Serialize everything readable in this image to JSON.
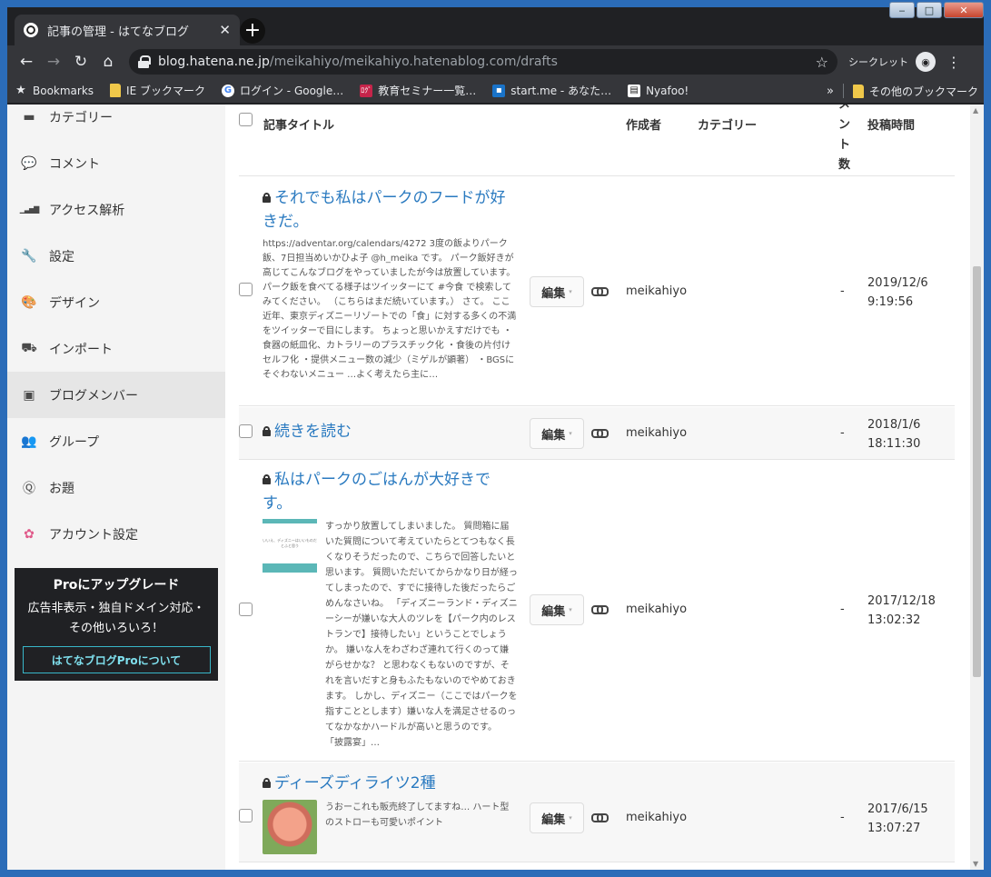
{
  "window": {
    "min_label": "‒",
    "max_label": "□",
    "close_label": "✕"
  },
  "tab": {
    "title": "記事の管理 - はてなブログ",
    "close": "✕",
    "new_tab": "+"
  },
  "toolbar": {
    "back": "←",
    "forward": "→",
    "reload": "↻",
    "home": "⌂",
    "url_host": "blog.hatena.ne.jp",
    "url_path": "/meikahiyo/meikahiyo.hatenablog.com/drafts",
    "star": "☆",
    "incognito_label": "シークレット",
    "incognito_icon": "◉",
    "menu": "⋮"
  },
  "bookmarks": {
    "items": [
      {
        "label": "Bookmarks",
        "icon": "star-icon",
        "glyph": "★"
      },
      {
        "label": "IE ブックマーク",
        "icon": "folder-icon",
        "glyph": ""
      },
      {
        "label": "ログイン - Google…",
        "icon": "google-icon",
        "glyph": "G"
      },
      {
        "label": "教育セミナー一覧…",
        "icon": "seminar-icon",
        "glyph": "ﾛｸﾞ"
      },
      {
        "label": "start.me - あなた…",
        "icon": "startme-icon",
        "glyph": "▪"
      },
      {
        "label": "Nyafoo!",
        "icon": "nyafoo-icon",
        "glyph": "▤"
      }
    ],
    "more": "»",
    "other_label": "その他のブックマーク"
  },
  "sidebar": {
    "items": [
      {
        "label": "カテゴリー",
        "icon": "folder-icon",
        "glyph": "▬"
      },
      {
        "label": "コメント",
        "icon": "comment-icon",
        "glyph": "💬"
      },
      {
        "label": "アクセス解析",
        "icon": "chart-icon",
        "glyph": "▁▃▅▇"
      },
      {
        "label": "設定",
        "icon": "wrench-icon",
        "glyph": "🔧"
      },
      {
        "label": "デザイン",
        "icon": "palette-icon",
        "glyph": "🎨"
      },
      {
        "label": "インポート",
        "icon": "truck-icon",
        "glyph": "⛟"
      },
      {
        "label": "ブログメンバー",
        "icon": "member-icon",
        "glyph": "▣"
      },
      {
        "label": "グループ",
        "icon": "group-icon",
        "glyph": "👥"
      },
      {
        "label": "お題",
        "icon": "odai-icon",
        "glyph": "Ⓠ"
      },
      {
        "label": "アカウント設定",
        "icon": "account-icon",
        "glyph": "✿"
      }
    ],
    "pro": {
      "title": "Proにアップグレード",
      "desc": "広告非表示・独自ドメイン対応・その他いろいろ！",
      "button": "はてなブログProについて"
    }
  },
  "table": {
    "headers": {
      "title": "記事タイトル",
      "author": "作成者",
      "category": "カテゴリー",
      "comments": "メント数",
      "date": "投稿時間"
    },
    "edit_label": "編集",
    "caret": "▾",
    "rows": [
      {
        "title": "それでも私はパークのフードが好きだ。",
        "excerpt": "https://adventar.org/calendars/4272 3度の飯よりパーク飯、7日担当めいかひよ子 @h_meika です。 パーク飯好きが高じてこんなブログをやっていましたが今は放置しています。 パーク飯を食べてる様子はツイッターにて #今食 で検索してみてください。 （こちらはまだ続いています。） さて。 ここ近年、東京ディズニーリゾートでの「食」に対する多くの不満をツイッターで目にします。 ちょっと思いかえすだけでも ・食器の紙皿化、カトラリーのプラスチック化 ・食後の片付けセルフ化 ・提供メニュー数の減少（ミゲルが顕著） ・BGSにそぐわないメニュー …よく考えたら主に…",
        "author": "meikahiyo",
        "comments": "-",
        "date": "2019/12/6",
        "time": "9:19:56"
      },
      {
        "title": "続きを読む",
        "excerpt": "",
        "author": "meikahiyo",
        "comments": "-",
        "date": "2018/1/6",
        "time": "18:11:30"
      },
      {
        "title": "私はパークのごはんが大好きです。",
        "excerpt": "すっかり放置してしまいました。 質問箱に届いた質問について考えていたらとてつもなく長くなりそうだったので、こちらで回答したいと思います。 質問いただいてからかなり日が経ってしまったので、すでに接待した後だったらごめんなさいね。 「ディズニーランド・ディズニーシーが嫌いな大人のツレを【パーク内のレストランで】接待したい」ということでしょうか。 嫌いな人をわざわざ連れて行くのって嫌がらせかな？ と思わなくもないのですが、それを言いだすと身もふたもないのでやめておきます。 しかし、ディズニー（ここではパークを指すこととします）嫌いな人を満足させるのってなかなかハードルが高いと思うのです。 「披露宴」…",
        "thumb_text": "いいえ、ディズニーはいいものだとふと思う",
        "author": "meikahiyo",
        "comments": "-",
        "date": "2017/12/18",
        "time": "13:02:32"
      },
      {
        "title": "ディーズディライツ2種",
        "excerpt": "うおーこれも販売終了してますね… ハート型のストローも可愛いポイント",
        "author": "meikahiyo",
        "comments": "-",
        "date": "2017/6/15",
        "time": "13:07:27"
      }
    ]
  }
}
